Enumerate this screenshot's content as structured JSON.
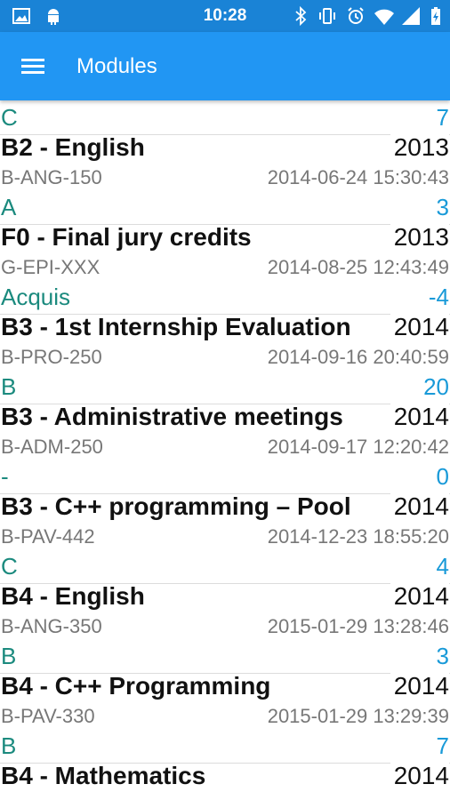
{
  "statusbar": {
    "time": "10:28"
  },
  "toolbar": {
    "title": "Modules"
  },
  "modules": [
    {
      "grade": "C",
      "credits": "7",
      "title": "B2 - English",
      "year": "2013",
      "code": "B-ANG-150",
      "date": "2014-06-24 15:30:43"
    },
    {
      "grade": "A",
      "credits": "3",
      "title": "F0 - Final jury credits",
      "year": "2013",
      "code": "G-EPI-XXX",
      "date": "2014-08-25 12:43:49"
    },
    {
      "grade": "Acquis",
      "credits": "-4",
      "title": "B3 - 1st Internship Evaluation",
      "year": "2014",
      "code": "B-PRO-250",
      "date": "2014-09-16 20:40:59"
    },
    {
      "grade": "B",
      "credits": "20",
      "title": "B3 - Administrative meetings",
      "year": "2014",
      "code": "B-ADM-250",
      "date": "2014-09-17 12:20:42"
    },
    {
      "grade": "-",
      "credits": "0",
      "title": "B3 - C++ programming – Pool",
      "year": "2014",
      "code": "B-PAV-442",
      "date": "2014-12-23 18:55:20"
    },
    {
      "grade": "C",
      "credits": "4",
      "title": "B4 - English",
      "year": "2014",
      "code": "B-ANG-350",
      "date": "2015-01-29 13:28:46"
    },
    {
      "grade": "B",
      "credits": "3",
      "title": "B4 - C++ Programming",
      "year": "2014",
      "code": "B-PAV-330",
      "date": "2015-01-29 13:29:39"
    },
    {
      "grade": "B",
      "credits": "7",
      "title": "B4 - Mathematics",
      "year": "2014",
      "code": "",
      "date": ""
    }
  ]
}
